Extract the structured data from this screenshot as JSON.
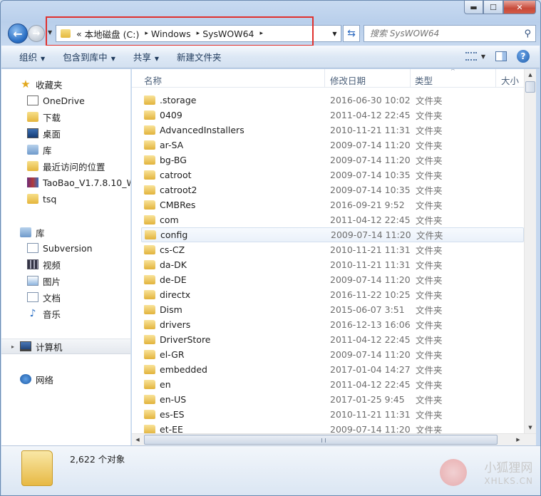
{
  "window": {
    "caption_buttons": {
      "minimize": "▬",
      "maximize": "☐",
      "close": "✕"
    }
  },
  "nav": {
    "back_icon": "←",
    "forward_icon": "→",
    "address": {
      "overflow": "«",
      "segments": [
        "本地磁盘 (C:)",
        "Windows",
        "SysWOW64"
      ],
      "separator": "▸"
    },
    "dropdown_icon": "▼",
    "refresh_icon": "⇆",
    "search": {
      "placeholder": "搜索 SysWOW64",
      "icon": "⚲"
    }
  },
  "toolbar": {
    "organize": "组织",
    "include_in_library": "包含到库中",
    "share": "共享",
    "new_folder": "新建文件夹",
    "caret": "▼",
    "help": "?"
  },
  "navpane": {
    "favorites": {
      "label": "收藏夹",
      "items": [
        {
          "label": "OneDrive",
          "icon": "onedrive-icon"
        },
        {
          "label": "下载",
          "icon": "downloads-folder-icon"
        },
        {
          "label": "桌面",
          "icon": "desktop-icon"
        },
        {
          "label": "库",
          "icon": "library-icon"
        },
        {
          "label": "最近访问的位置",
          "icon": "recent-places-icon"
        },
        {
          "label": "TaoBao_V1.7.8.10_Wi",
          "icon": "rar-archive-icon"
        },
        {
          "label": "tsq",
          "icon": "folder-icon"
        }
      ]
    },
    "libraries": {
      "label": "库",
      "items": [
        {
          "label": "Subversion",
          "icon": "subversion-icon"
        },
        {
          "label": "视频",
          "icon": "video-icon"
        },
        {
          "label": "图片",
          "icon": "pictures-icon"
        },
        {
          "label": "文档",
          "icon": "documents-icon"
        },
        {
          "label": "音乐",
          "icon": "music-icon"
        }
      ]
    },
    "computer": {
      "label": "计算机"
    },
    "network": {
      "label": "网络"
    }
  },
  "list": {
    "columns": {
      "name": "名称",
      "modified": "修改日期",
      "type": "类型",
      "size": "大小"
    },
    "sort_indicator": "^",
    "selected_row": "config",
    "rows": [
      {
        "name": ".storage",
        "date": "2016-06-30 10:02",
        "type": "文件夹"
      },
      {
        "name": "0409",
        "date": "2011-04-12 22:45",
        "type": "文件夹"
      },
      {
        "name": "AdvancedInstallers",
        "date": "2010-11-21 11:31",
        "type": "文件夹"
      },
      {
        "name": "ar-SA",
        "date": "2009-07-14 11:20",
        "type": "文件夹"
      },
      {
        "name": "bg-BG",
        "date": "2009-07-14 11:20",
        "type": "文件夹"
      },
      {
        "name": "catroot",
        "date": "2009-07-14 10:35",
        "type": "文件夹"
      },
      {
        "name": "catroot2",
        "date": "2009-07-14 10:35",
        "type": "文件夹"
      },
      {
        "name": "CMBRes",
        "date": "2016-09-21 9:52",
        "type": "文件夹"
      },
      {
        "name": "com",
        "date": "2011-04-12 22:45",
        "type": "文件夹"
      },
      {
        "name": "config",
        "date": "2009-07-14 11:20",
        "type": "文件夹"
      },
      {
        "name": "cs-CZ",
        "date": "2010-11-21 11:31",
        "type": "文件夹"
      },
      {
        "name": "da-DK",
        "date": "2010-11-21 11:31",
        "type": "文件夹"
      },
      {
        "name": "de-DE",
        "date": "2009-07-14 11:20",
        "type": "文件夹"
      },
      {
        "name": "directx",
        "date": "2016-11-22 10:25",
        "type": "文件夹"
      },
      {
        "name": "Dism",
        "date": "2015-06-07 3:51",
        "type": "文件夹"
      },
      {
        "name": "drivers",
        "date": "2016-12-13 16:06",
        "type": "文件夹"
      },
      {
        "name": "DriverStore",
        "date": "2011-04-12 22:45",
        "type": "文件夹"
      },
      {
        "name": "el-GR",
        "date": "2009-07-14 11:20",
        "type": "文件夹"
      },
      {
        "name": "embedded",
        "date": "2017-01-04 14:27",
        "type": "文件夹"
      },
      {
        "name": "en",
        "date": "2011-04-12 22:45",
        "type": "文件夹"
      },
      {
        "name": "en-US",
        "date": "2017-01-25 9:45",
        "type": "文件夹"
      },
      {
        "name": "es-ES",
        "date": "2010-11-21 11:31",
        "type": "文件夹"
      },
      {
        "name": "et-EE",
        "date": "2009-07-14 11:20",
        "type": "文件夹"
      }
    ]
  },
  "scroll": {
    "up": "▲",
    "down": "▼",
    "left": "◀",
    "right": "▶"
  },
  "status": {
    "count": "2,622 个对象"
  },
  "watermark": {
    "line1": "小狐狸网",
    "line2": "XHLKS.CN"
  },
  "colors": {
    "highlight_box": "#e0312e",
    "accent": "#2a6fc4"
  }
}
